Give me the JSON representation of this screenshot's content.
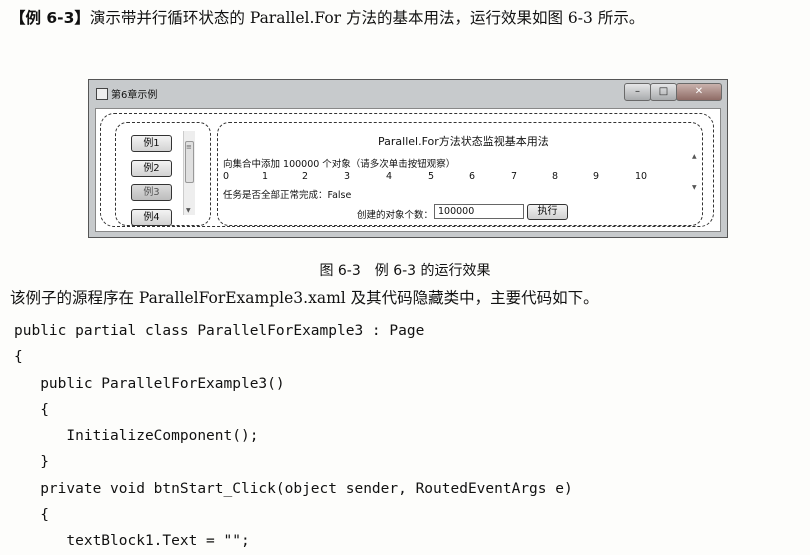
{
  "intro": {
    "label": "【例 6-3】",
    "text": "演示带并行循环状态的 Parallel.For 方法的基本用法，运行效果如图 6-3 所示。"
  },
  "window": {
    "title": "第6章示例",
    "min_glyph": "–",
    "max_glyph": "□",
    "close_glyph": "✕",
    "example_buttons": [
      "例1",
      "例2",
      "例3",
      "例4"
    ],
    "selected_example": "例3",
    "grip_glyph": "≡",
    "scroll_down_glyph": "▼",
    "scroll_up_glyph": "▲",
    "panel_title": "Parallel.For方法状态监视基本用法",
    "prompt": "向集合中添加 100000 个对象（请多次单击按钮观察）",
    "numbers": [
      "0",
      "1",
      "2",
      "3",
      "4",
      "5",
      "6",
      "7",
      "8",
      "9",
      "10"
    ],
    "status": "任务是否全部正常完成：False",
    "count_label": "创建的对象个数：",
    "count_value": "100000",
    "run_label": "执行"
  },
  "caption": {
    "figure": "图 6-3",
    "text": "例 6-3 的运行效果"
  },
  "paragraph": "该例子的源程序在 ParallelForExample3.xaml 及其代码隐藏类中，主要代码如下。",
  "code": [
    "public partial class ParallelForExample3 : Page",
    "{",
    "   public ParallelForExample3()",
    "   {",
    "      InitializeComponent();",
    "   }",
    "   private void btnStart_Click(object sender, RoutedEventArgs e)",
    "   {",
    "      textBlock1.Text = \"\";"
  ]
}
